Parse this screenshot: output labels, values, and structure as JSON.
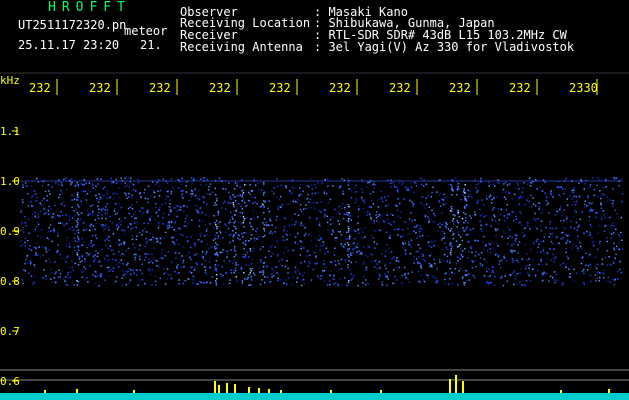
{
  "header": {
    "brand": "HROFFT",
    "file_name": "UT2511172320.pn",
    "tag": "meteor",
    "datetime": "25.11.17 23:20",
    "count": "21.",
    "observer_label": "Observer",
    "observer_value": ": Masaki Kano",
    "location_label": "Receiving Location",
    "location_value": ": Shibukawa, Gunma, Japan",
    "receiver_label": "Receiver",
    "receiver_value": ": RTL-SDR SDR# 43dB L15 103.2MHz CW",
    "antenna_label": "Receiving Antenna",
    "antenna_value": ": 3el Yagi(V) Az 330 for Vladivostok"
  },
  "axes": {
    "y_unit": "kHz",
    "y_ticks": [
      "1.1",
      "1.0",
      "0.9",
      "0.8",
      "0.7",
      "0.6"
    ],
    "x_ticks": [
      "232",
      "232",
      "232",
      "232",
      "232",
      "232",
      "232",
      "232",
      "232",
      "2330"
    ]
  },
  "colors": {
    "background": "#000000",
    "text": "#ffffff",
    "axis_text": "#ffff00",
    "brand": "#00ff66",
    "signal": "#2a4cff",
    "baseline": "#00cccc",
    "spike": "#ffff00"
  }
}
